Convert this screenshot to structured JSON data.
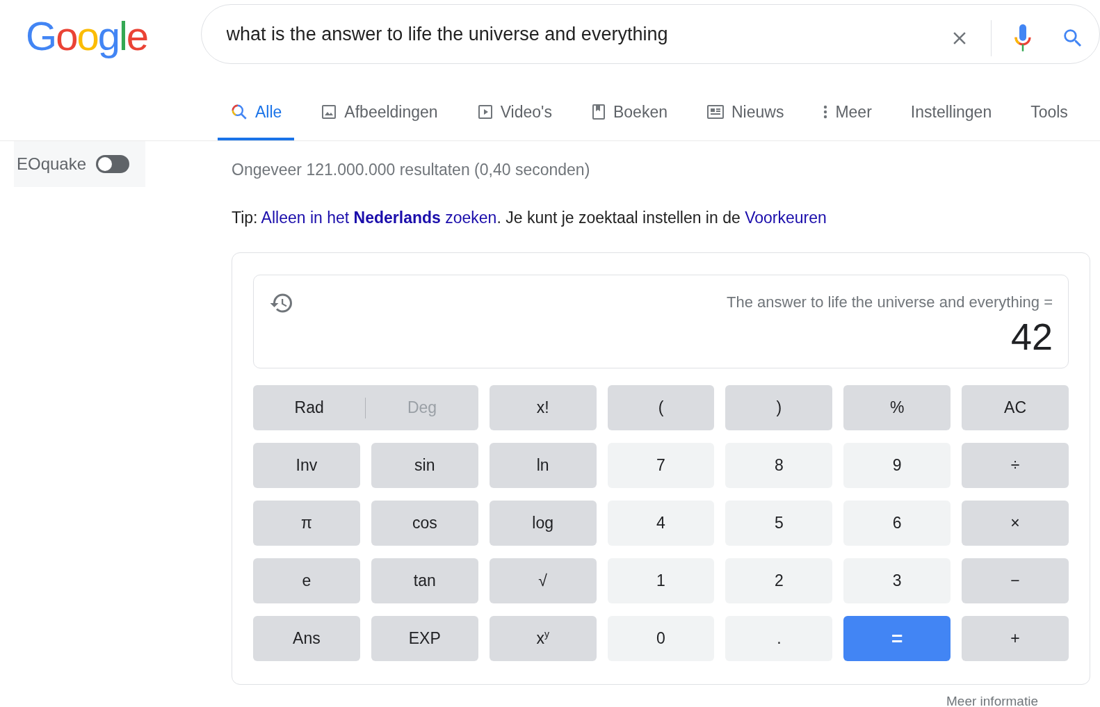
{
  "logo": {
    "text": "Google"
  },
  "search": {
    "value": "what is the answer to life the universe and everything"
  },
  "tabs": [
    {
      "label": "Alle",
      "selected": true
    },
    {
      "label": "Afbeeldingen",
      "selected": false
    },
    {
      "label": "Video's",
      "selected": false
    },
    {
      "label": "Boeken",
      "selected": false
    },
    {
      "label": "Nieuws",
      "selected": false
    },
    {
      "label": "Meer",
      "selected": false
    },
    {
      "label": "Instellingen",
      "selected": false
    },
    {
      "label": "Tools",
      "selected": false
    }
  ],
  "seoquake": {
    "label": "EOquake",
    "on": false
  },
  "result_stats": "Ongeveer 121.000.000 resultaten (0,40 seconden)",
  "tip": [
    {
      "kind": "text",
      "text": "Tip: "
    },
    {
      "kind": "link",
      "text": "Alleen in het **Nederlands** zoeken"
    },
    {
      "kind": "text",
      "text": ". Je kunt je zoektaal instellen in de "
    },
    {
      "kind": "link",
      "text": "Voorkeuren"
    }
  ],
  "calculator": {
    "expression": "The answer to life the universe and everything =",
    "result": "42",
    "keys": [
      {
        "kind": "mode",
        "options": [
          {
            "label": "Rad",
            "selected": true
          },
          {
            "label": "Deg",
            "selected": false
          }
        ]
      },
      {
        "kind": "func",
        "label": "x!"
      },
      {
        "kind": "func",
        "label": "("
      },
      {
        "kind": "func",
        "label": ")"
      },
      {
        "kind": "func",
        "label": "%"
      },
      {
        "kind": "func",
        "label": "AC"
      },
      {
        "kind": "func",
        "label": "Inv"
      },
      {
        "kind": "func",
        "label": "sin"
      },
      {
        "kind": "func",
        "label": "ln"
      },
      {
        "kind": "num",
        "label": "7"
      },
      {
        "kind": "num",
        "label": "8"
      },
      {
        "kind": "num",
        "label": "9"
      },
      {
        "kind": "func",
        "label": "÷"
      },
      {
        "kind": "func",
        "label": "π"
      },
      {
        "kind": "func",
        "label": "cos"
      },
      {
        "kind": "func",
        "label": "log"
      },
      {
        "kind": "num",
        "label": "4"
      },
      {
        "kind": "num",
        "label": "5"
      },
      {
        "kind": "num",
        "label": "6"
      },
      {
        "kind": "func",
        "label": "×"
      },
      {
        "kind": "func",
        "label": "e"
      },
      {
        "kind": "func",
        "label": "tan"
      },
      {
        "kind": "func",
        "label": "√"
      },
      {
        "kind": "num",
        "label": "1"
      },
      {
        "kind": "num",
        "label": "2"
      },
      {
        "kind": "num",
        "label": "3"
      },
      {
        "kind": "func",
        "label": "−"
      },
      {
        "kind": "func",
        "label": "Ans"
      },
      {
        "kind": "func",
        "label": "EXP"
      },
      {
        "kind": "func",
        "label": "x$^{y}$"
      },
      {
        "kind": "num",
        "label": "0"
      },
      {
        "kind": "num",
        "label": "."
      },
      {
        "kind": "equals",
        "label": "="
      },
      {
        "kind": "func",
        "label": "+"
      }
    ]
  },
  "more_info": "Meer informatie"
}
